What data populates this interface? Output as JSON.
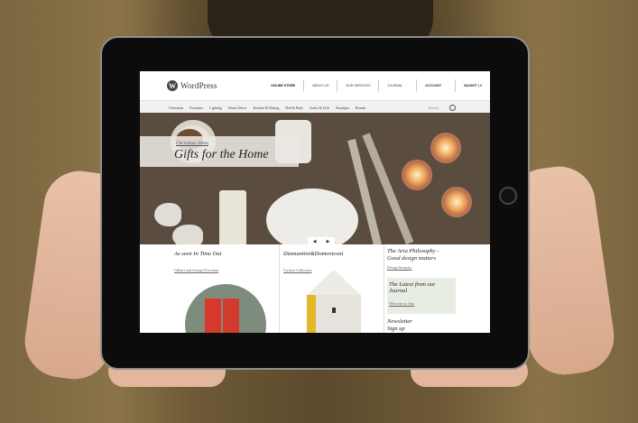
{
  "site": {
    "logo_mark": "W",
    "logo_text": "WordPress"
  },
  "topnav": [
    "ONLINE STORE",
    "ABOUT US",
    "OUR SERVICES",
    "JOURNAL",
    "ACCOUNT",
    "BASKET | 0"
  ],
  "categories": [
    "Christmas",
    "Furniture",
    "Lighting",
    "Home Décor",
    "Kitchen & Dining",
    "Bed & Bath",
    "Audio & Tech",
    "Boutique",
    "Brands"
  ],
  "search": {
    "placeholder": "Search"
  },
  "hero": {
    "kicker": "Christmas Ideas",
    "headline": "Gifts for the Home",
    "prev": "◀",
    "next": "▶"
  },
  "col1": {
    "title": "As seen In Time Out",
    "link": "Gilbert and George Porcelain"
  },
  "col2": {
    "title": "Diamantini&Domeniconi",
    "link": "Cuckoo Collection"
  },
  "col3": {
    "title_line1": "The Aria Philosophy -",
    "title_line2": "Good design matters",
    "link": "Design Integrity",
    "journal_title": "The Latest from our Journal",
    "journal_link": "Welcome to Aria",
    "newsletter_line1": "Newsletter",
    "newsletter_line2": "Sign up"
  }
}
